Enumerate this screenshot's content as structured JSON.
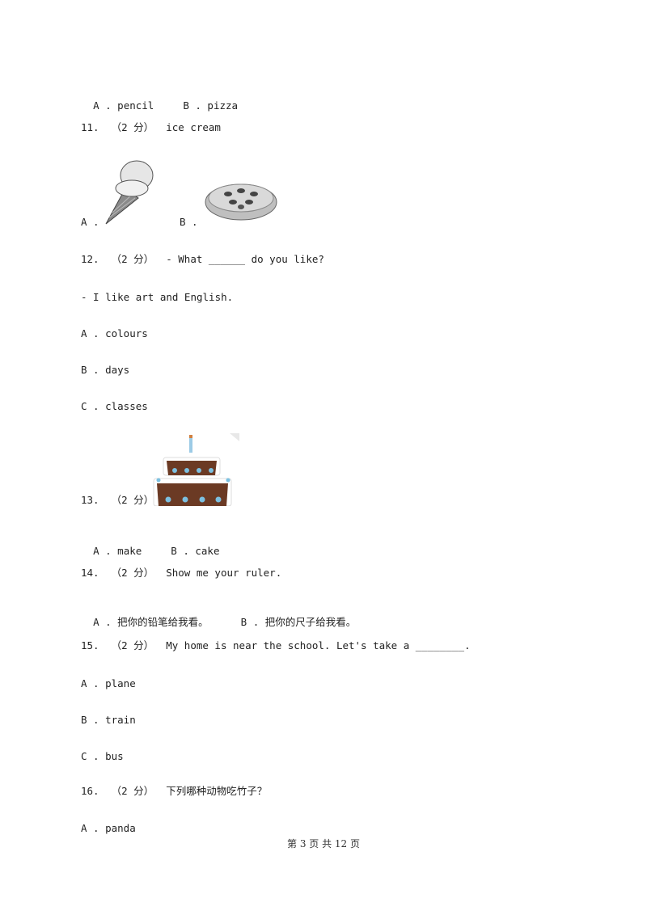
{
  "q10_options": {
    "a": "A . pencil",
    "b": "B . pizza"
  },
  "q11": {
    "stem": "11.  （2 分）  ice cream",
    "a_label": "A .",
    "b_label": "B ."
  },
  "q12": {
    "stem": "12.  （2 分）  - What ______ do you like?",
    "reply": "- I like art and English.",
    "options": [
      "A . colours",
      "B . days",
      "C . classes"
    ]
  },
  "q13": {
    "stem": "13.  （2 分）",
    "a": "A . make",
    "b": "B . cake"
  },
  "q14": {
    "stem": "14.  （2 分）  Show me your ruler.",
    "a": "A . 把你的铅笔给我看。",
    "b": "B . 把你的尺子给我看。"
  },
  "q15": {
    "stem": "15.  （2 分）  My home is near the school. Let's take a ________.",
    "options": [
      "A . plane",
      "B . train",
      "C . bus"
    ]
  },
  "q16": {
    "stem": "16.  （2 分）  下列哪种动物吃竹子？",
    "options": [
      "A . panda"
    ]
  },
  "footer": "第 3 页 共 12 页"
}
